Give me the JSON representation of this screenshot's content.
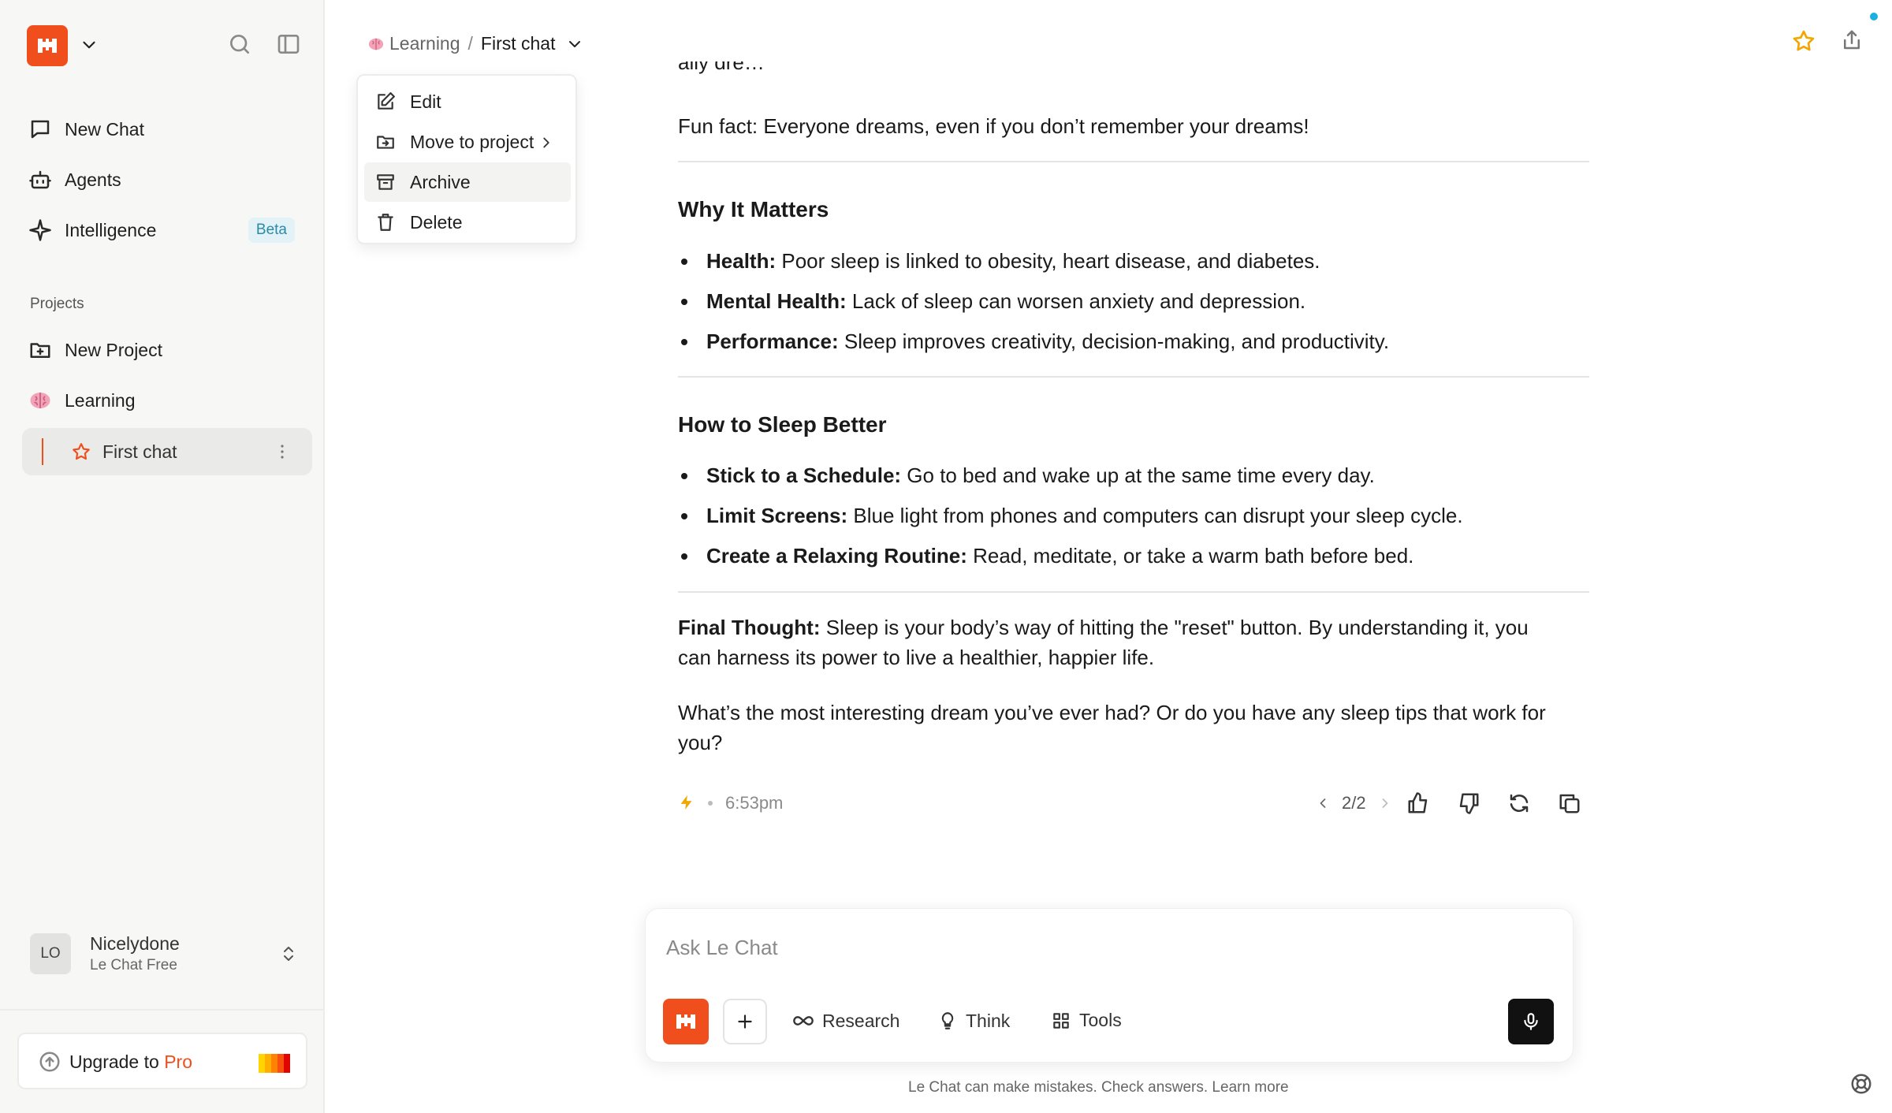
{
  "sidebar": {
    "nav": [
      {
        "label": "New Chat",
        "icon": "chat-bubble-icon"
      },
      {
        "label": "Agents",
        "icon": "robot-icon"
      },
      {
        "label": "Intelligence",
        "icon": "sparkle-icon",
        "badge": "Beta"
      }
    ],
    "projects_label": "Projects",
    "projects": [
      {
        "label": "New Project",
        "icon": "folder-plus-icon"
      },
      {
        "label": "Learning",
        "icon": "brain-icon"
      }
    ],
    "active_chat": "First chat",
    "user": {
      "initials": "LO",
      "name": "Nicelydone",
      "plan": "Le Chat Free"
    },
    "upgrade": {
      "prefix": "Upgrade to ",
      "highlight": "Pro"
    }
  },
  "header": {
    "project": "Learning",
    "separator": "/",
    "chat_title": "First chat"
  },
  "menu": {
    "items": [
      {
        "label": "Edit",
        "icon": "edit-icon"
      },
      {
        "label": "Move to project",
        "icon": "folder-move-icon"
      },
      {
        "label": "Archive",
        "icon": "archive-icon"
      },
      {
        "label": "Delete",
        "icon": "trash-icon"
      }
    ]
  },
  "message": {
    "fun_fact": "Fun fact: Everyone dreams, even if you don’t remember your dreams!",
    "section1": {
      "heading": "Why It Matters",
      "items": [
        {
          "bold": "Health:",
          "text": " Poor sleep is linked to obesity, heart disease, and diabetes."
        },
        {
          "bold": "Mental Health:",
          "text": " Lack of sleep can worsen anxiety and depression."
        },
        {
          "bold": "Performance:",
          "text": " Sleep improves creativity, decision-making, and productivity."
        }
      ]
    },
    "section2": {
      "heading": "How to Sleep Better",
      "items": [
        {
          "bold": "Stick to a Schedule:",
          "text": " Go to bed and wake up at the same time every day."
        },
        {
          "bold": "Limit Screens:",
          "text": " Blue light from phones and computers can disrupt your sleep cycle."
        },
        {
          "bold": "Create a Relaxing Routine:",
          "text": " Read, meditate, or take a warm bath before bed."
        }
      ]
    },
    "final_bold": "Final Thought:",
    "final_line1": " Sleep is your body’s way of hitting the \"reset\" button. By understanding it, you",
    "final_line2": "can harness its power to live a healthier, happier life.",
    "question_line1": "What’s the most interesting dream you’ve ever had? Or do you have any sleep tips that work for",
    "question_line2": "you?",
    "time": "6:53pm",
    "pager": "2/2"
  },
  "composer": {
    "placeholder": "Ask Le Chat",
    "tools": [
      {
        "label": "Research",
        "icon": "infinity-icon"
      },
      {
        "label": "Think",
        "icon": "lightbulb-icon"
      },
      {
        "label": "Tools",
        "icon": "grid-icon"
      }
    ]
  },
  "disclaimer": "Le Chat can make mistakes. Check answers. Learn more",
  "colors": {
    "brand": "#f04e1c",
    "accent_star": "#f0a800",
    "beta_text": "#2b8aa8"
  }
}
